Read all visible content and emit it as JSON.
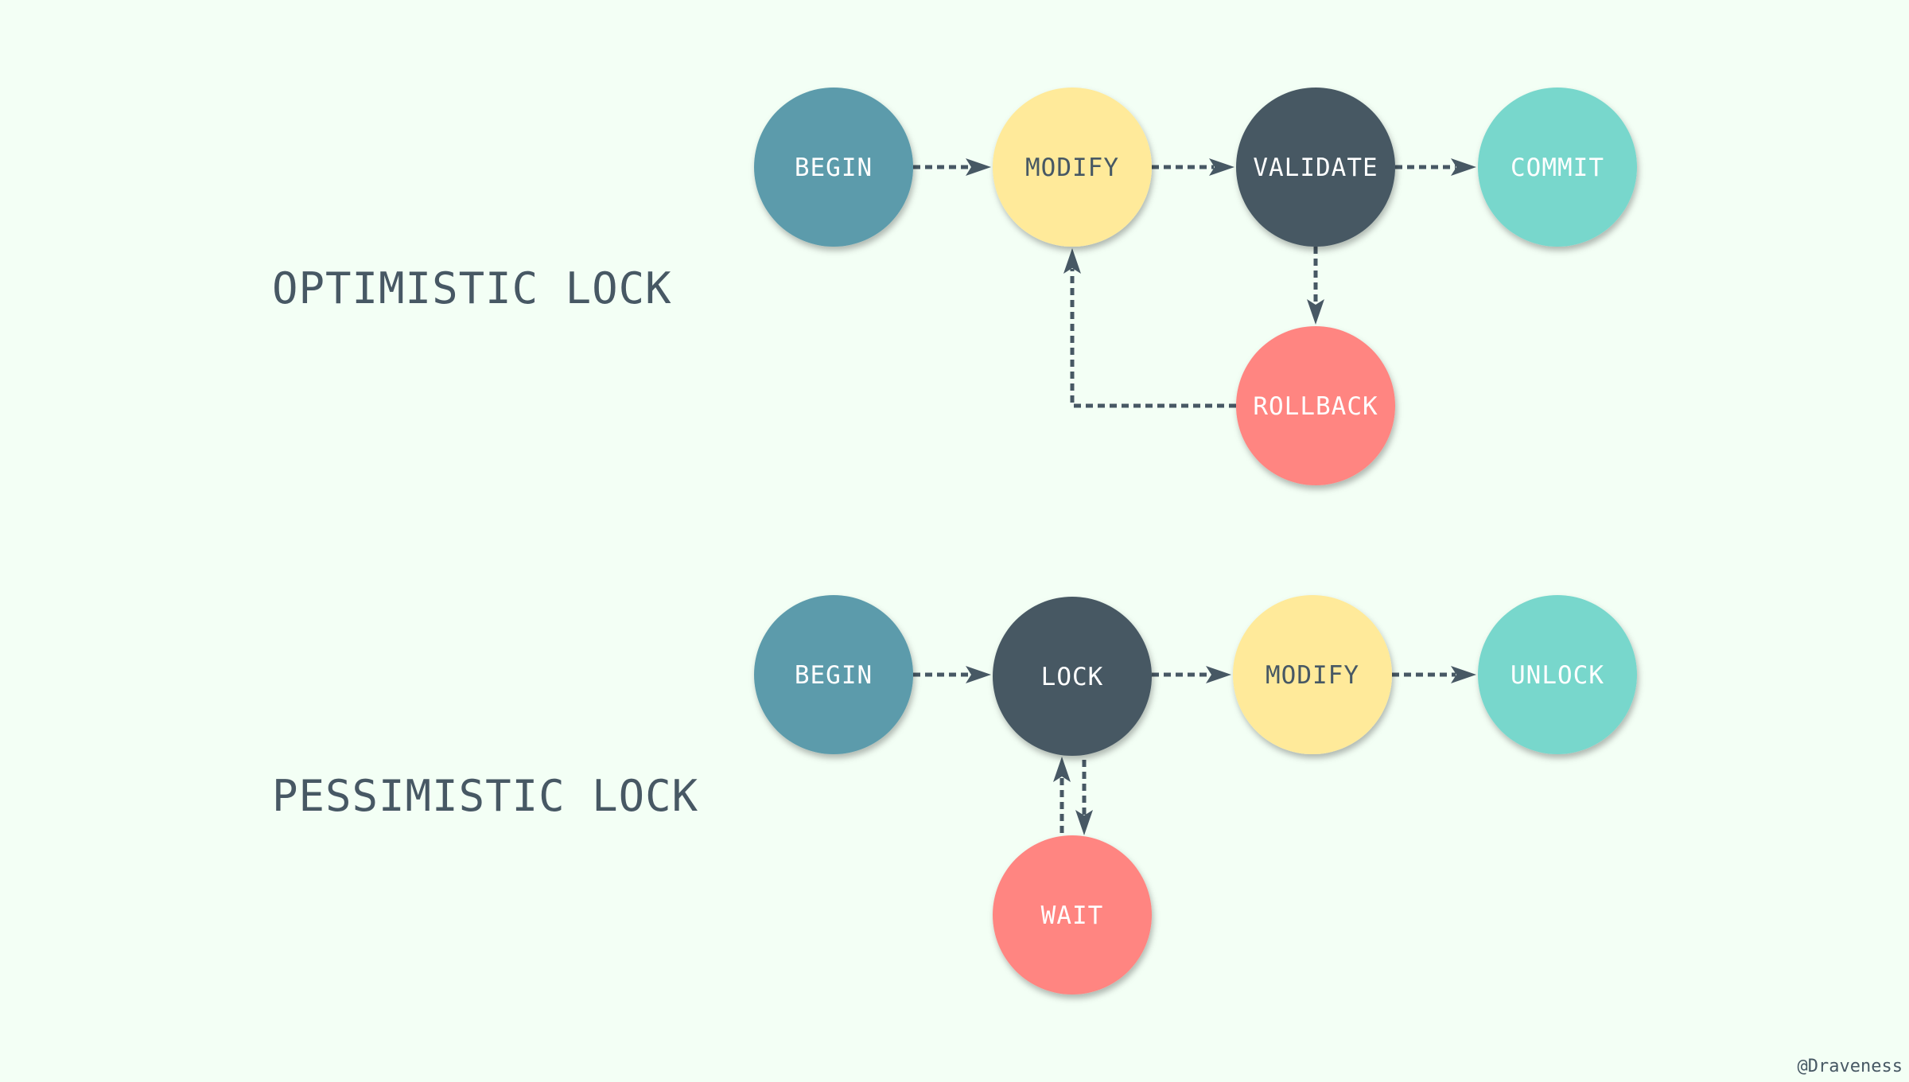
{
  "colors": {
    "background": "#F3FFF5",
    "ink": "#475864",
    "begin": "#5B9BAB",
    "modify": "#FFEA9A",
    "dark": "#475864",
    "end": "#78D7CC",
    "alert": "#FF8581",
    "light_text": "#FFFFFF"
  },
  "optimistic": {
    "title": "OPTIMISTIC LOCK",
    "nodes": [
      {
        "id": "begin",
        "label": "BEGIN",
        "color": "#5B9BAB",
        "text_color": "#FFFFFF"
      },
      {
        "id": "modify",
        "label": "MODIFY",
        "color": "#FFEA9A",
        "text_color": "#475864"
      },
      {
        "id": "validate",
        "label": "VALIDATE",
        "color": "#475864",
        "text_color": "#FFFFFF"
      },
      {
        "id": "commit",
        "label": "COMMIT",
        "color": "#78D7CC",
        "text_color": "#FFFFFF"
      },
      {
        "id": "rollback",
        "label": "ROLLBACK",
        "color": "#FF8581",
        "text_color": "#FFFFFF"
      }
    ],
    "edges": [
      {
        "from": "begin",
        "to": "modify"
      },
      {
        "from": "modify",
        "to": "validate"
      },
      {
        "from": "validate",
        "to": "commit"
      },
      {
        "from": "validate",
        "to": "rollback"
      },
      {
        "from": "rollback",
        "to": "modify"
      }
    ]
  },
  "pessimistic": {
    "title": "PESSIMISTIC LOCK",
    "nodes": [
      {
        "id": "begin",
        "label": "BEGIN",
        "color": "#5B9BAB",
        "text_color": "#FFFFFF"
      },
      {
        "id": "lock",
        "label": "LOCK",
        "color": "#475864",
        "text_color": "#FFFFFF"
      },
      {
        "id": "modify",
        "label": "MODIFY",
        "color": "#FFEA9A",
        "text_color": "#475864"
      },
      {
        "id": "unlock",
        "label": "UNLOCK",
        "color": "#78D7CC",
        "text_color": "#FFFFFF"
      },
      {
        "id": "wait",
        "label": "WAIT",
        "color": "#FF8581",
        "text_color": "#FFFFFF"
      }
    ],
    "edges": [
      {
        "from": "begin",
        "to": "lock"
      },
      {
        "from": "lock",
        "to": "modify"
      },
      {
        "from": "modify",
        "to": "unlock"
      },
      {
        "from": "lock",
        "to": "wait"
      },
      {
        "from": "wait",
        "to": "lock"
      }
    ]
  },
  "watermark": "@Draveness"
}
